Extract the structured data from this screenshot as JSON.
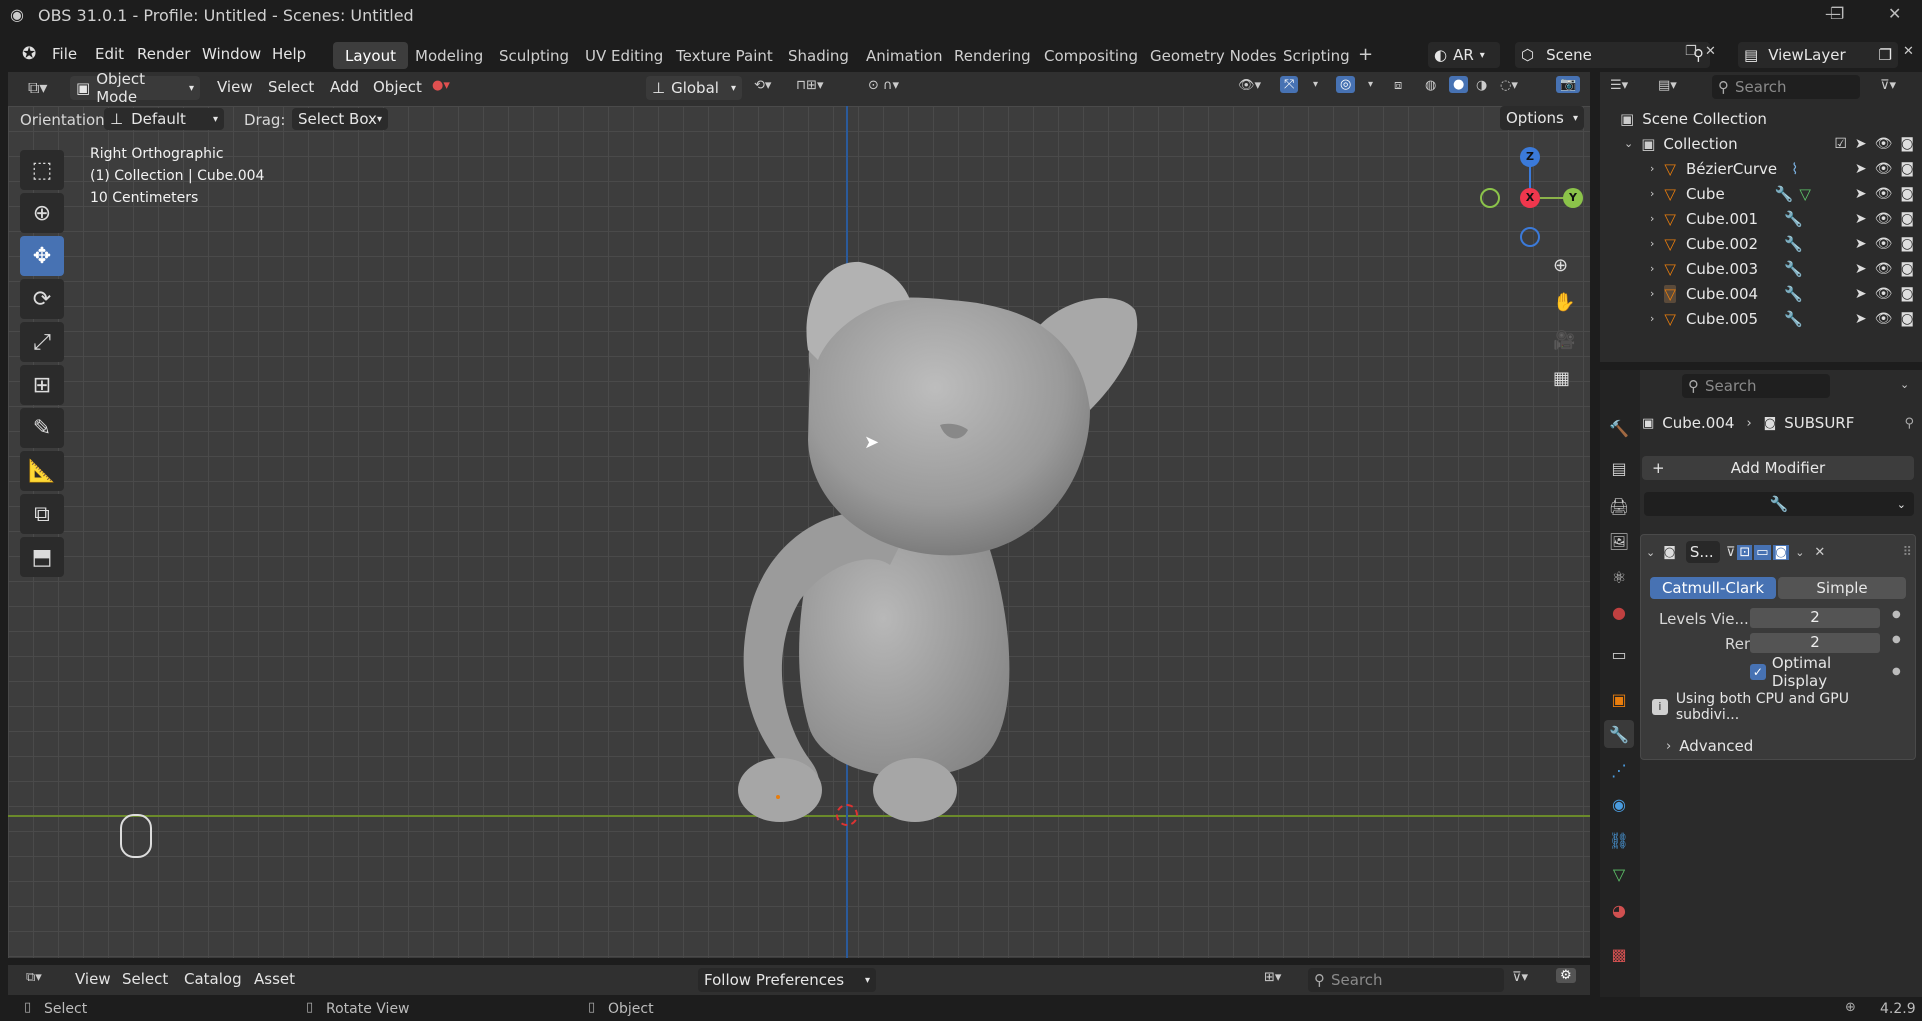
{
  "window": {
    "title": "OBS 31.0.1 - Profile: Untitled - Scenes: Untitled",
    "version": "4.2.9"
  },
  "menu": [
    "File",
    "Edit",
    "Render",
    "Window",
    "Help"
  ],
  "workspaces": [
    "Layout",
    "Modeling",
    "Sculpting",
    "UV Editing",
    "Texture Paint",
    "Shading",
    "Animation",
    "Rendering",
    "Compositing",
    "Geometry Nodes",
    "Scripting"
  ],
  "top_right": {
    "ar_label": "AR",
    "scene": "Scene",
    "view_layer": "ViewLayer"
  },
  "viewport_header": {
    "mode": "Object Mode",
    "menus": [
      "View",
      "Select",
      "Add",
      "Object"
    ],
    "transform": "Global",
    "options": "Options"
  },
  "tool_settings": {
    "orientation_label": "Orientation:",
    "orientation_value": "Default",
    "drag_label": "Drag:",
    "drag_value": "Select Box"
  },
  "viewport_info": {
    "line1": "Right Orthographic",
    "line2": "(1) Collection | Cube.004",
    "line3": "10 Centimeters"
  },
  "outliner": {
    "search_placeholder": "Search",
    "root": "Scene Collection",
    "collection": "Collection",
    "items": [
      "BézierCurve",
      "Cube",
      "Cube.001",
      "Cube.002",
      "Cube.003",
      "Cube.004",
      "Cube.005"
    ]
  },
  "properties": {
    "search_placeholder": "Search",
    "object": "Cube.004",
    "modifier_name": "SUBSURF",
    "add_modifier": "Add Modifier",
    "panel_name": "S...",
    "tab_catmull": "Catmull-Clark",
    "tab_simple": "Simple",
    "levels_label": "Levels Vie...",
    "levels_value": "2",
    "render_label": "Render",
    "render_value": "2",
    "optimal_display": "Optimal Display",
    "info": "Using both CPU and GPU subdivi...",
    "advanced": "Advanced"
  },
  "asset_bar": {
    "menus": [
      "View",
      "Select",
      "Catalog",
      "Asset"
    ],
    "follow": "Follow Preferences",
    "search_placeholder": "Search"
  },
  "status": {
    "select": "Select",
    "rotate": "Rotate View",
    "object": "Object"
  }
}
